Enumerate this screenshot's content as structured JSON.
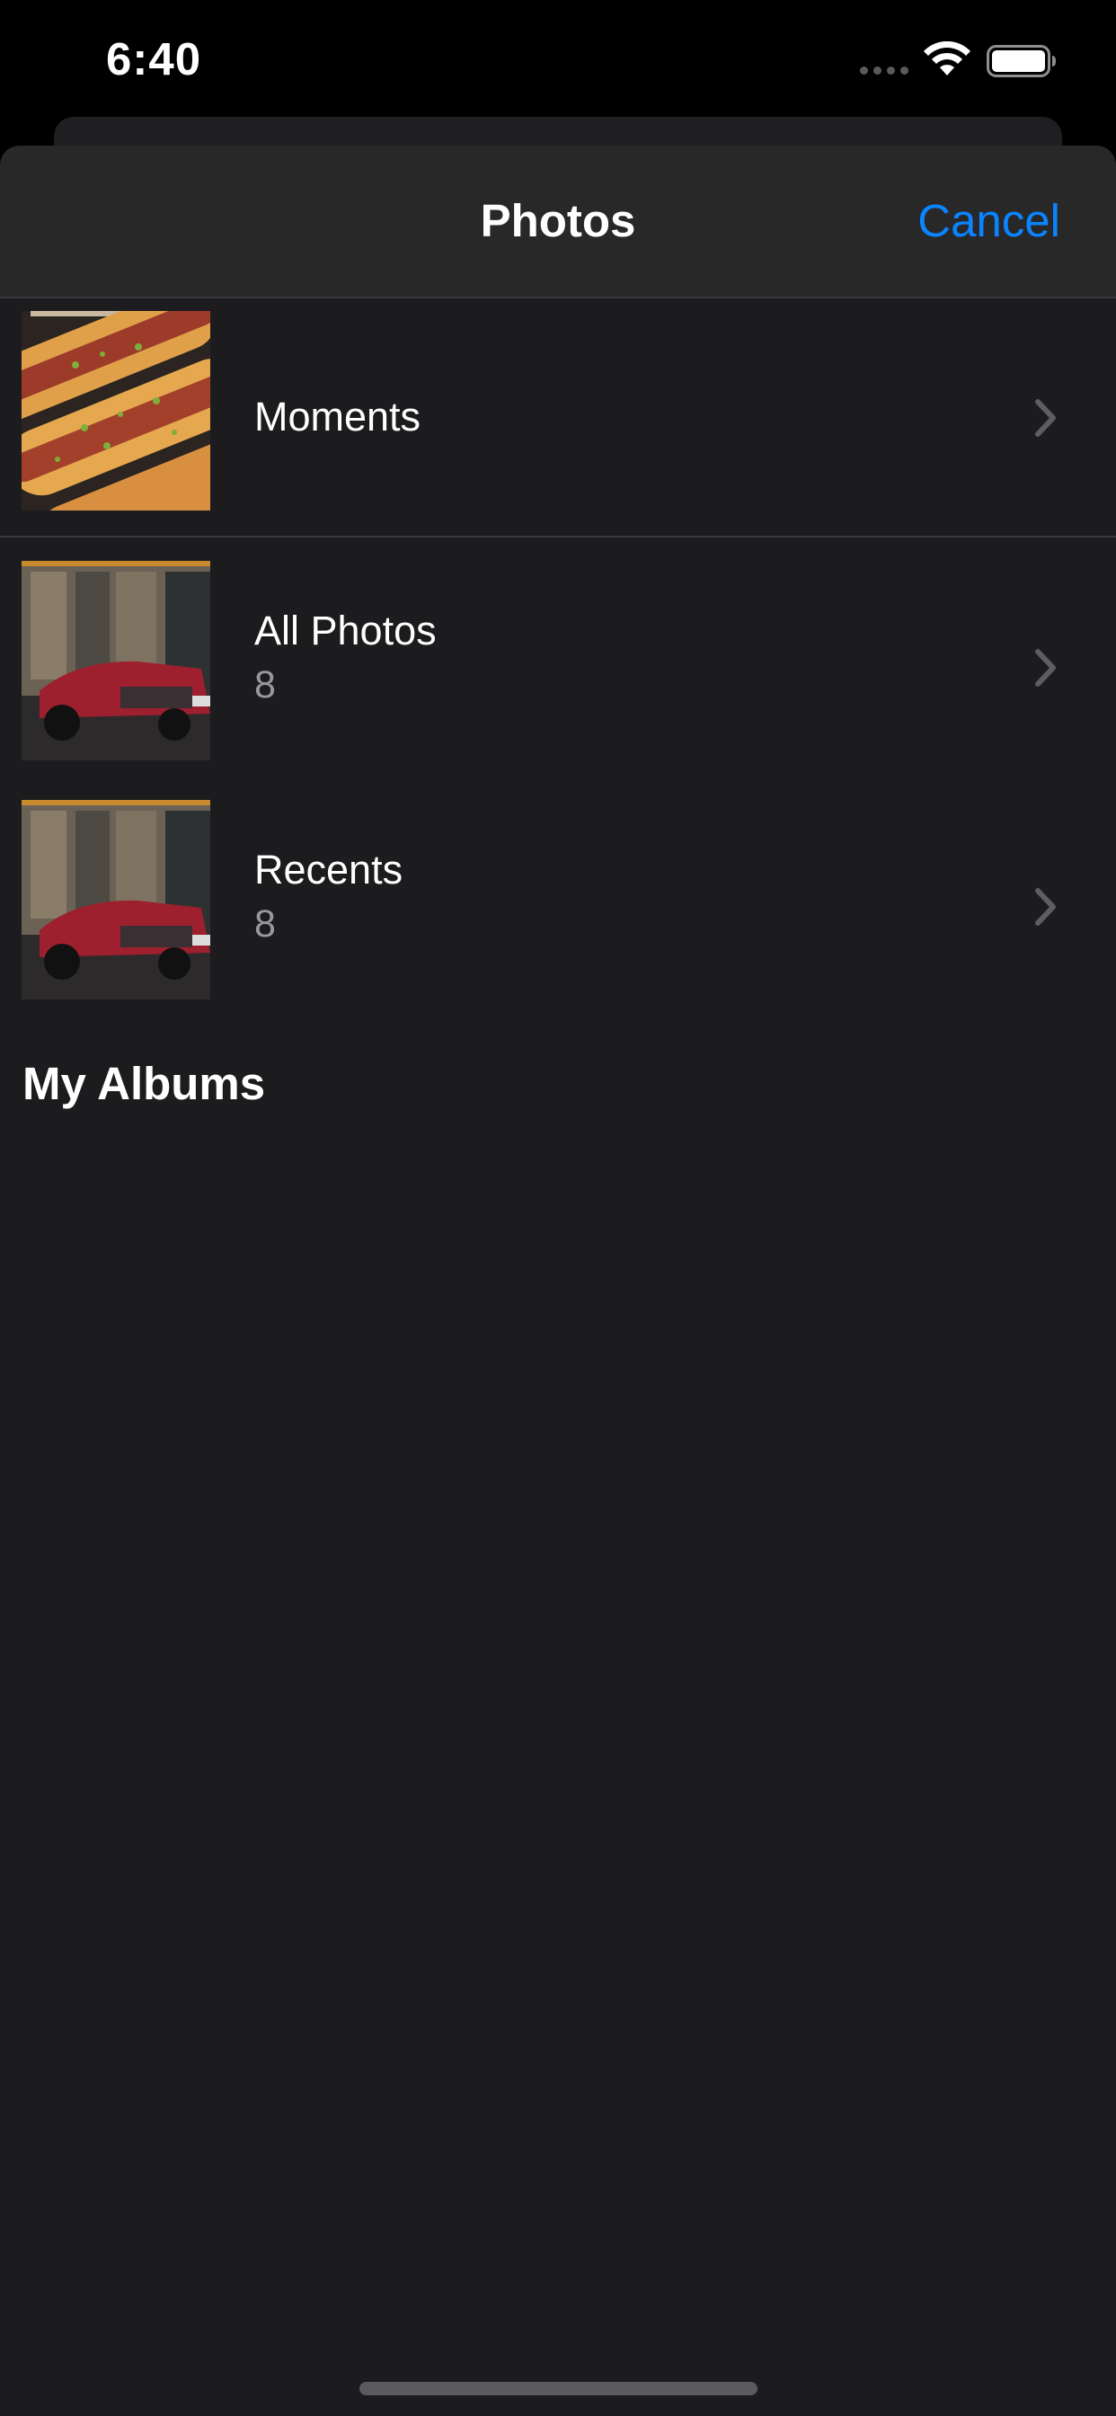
{
  "status_bar": {
    "time": "6:40"
  },
  "nav": {
    "title": "Photos",
    "cancel_label": "Cancel"
  },
  "albums": [
    {
      "name": "Moments",
      "count": "",
      "thumb_icon": "food-thumbnail"
    },
    {
      "name": "All Photos",
      "count": "8",
      "thumb_icon": "car-thumbnail"
    },
    {
      "name": "Recents",
      "count": "8",
      "thumb_icon": "car-thumbnail"
    }
  ],
  "section": {
    "my_albums_label": "My Albums"
  },
  "colors": {
    "accent": "#0a84ff",
    "sheet_background": "#1c1c1e",
    "nav_background": "#282829",
    "secondary_text": "#98989d"
  }
}
